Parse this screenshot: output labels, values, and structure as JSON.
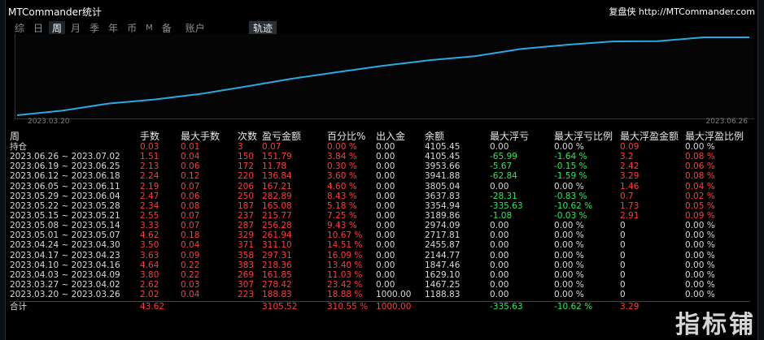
{
  "app": {
    "title": "MTCommander统计",
    "brand": "复盘侠 http://MTCommander.com"
  },
  "tabs": [
    {
      "label": "综",
      "active": false
    },
    {
      "label": "日",
      "active": false
    },
    {
      "label": "周",
      "active": true
    },
    {
      "label": "月",
      "active": false
    },
    {
      "label": "季",
      "active": false
    },
    {
      "label": "年",
      "active": false
    },
    {
      "label": "币",
      "active": false
    },
    {
      "label": "M",
      "active": false
    },
    {
      "label": "备",
      "active": false
    },
    {
      "label": "账户",
      "active": false
    }
  ],
  "track_button": "轨迹",
  "chart_data": {
    "type": "line",
    "x_start": "2023.03.20",
    "x_end": "2023.06.26",
    "series": [
      {
        "values": [
          0,
          188.83,
          467.25,
          629.1,
          847.46,
          1144.77,
          1455.89,
          1717.81,
          1974.09,
          2189.86,
          2354.94,
          2637.83,
          2804.97,
          2941.75,
          2953.53,
          3105.22,
          3105.22
        ]
      }
    ],
    "color": "#29a9e0"
  },
  "table": {
    "headers": [
      "周",
      "手数",
      "最大手数",
      "次数",
      "盈亏金额",
      "百分比%",
      "出入金",
      "余额",
      "最大浮亏",
      "最大浮亏比例",
      "最大浮盈金额",
      "最大浮盈比例"
    ],
    "rows": [
      [
        "持仓",
        "0.03",
        "0.01",
        "3",
        "0.07",
        "0.00 %",
        "0.00",
        "4105.45",
        "0.00",
        "0.00 %",
        "0.09",
        "0.00 %"
      ],
      [
        "2023.06.26 ~ 2023.07.02",
        "1.51",
        "0.04",
        "150",
        "151.79",
        "3.84 %",
        "0.00",
        "4105.45",
        "-65.99",
        "-1.64 %",
        "3.2",
        "0.08 %"
      ],
      [
        "2023.06.19 ~ 2023.06.25",
        "2.13",
        "0.06",
        "172",
        "11.78",
        "0.30 %",
        "0.00",
        "3953.66",
        "-5.67",
        "-0.15 %",
        "2.42",
        "0.06 %"
      ],
      [
        "2023.06.12 ~ 2023.06.18",
        "2.24",
        "0.12",
        "220",
        "136.84",
        "3.60 %",
        "0.00",
        "3941.88",
        "-62.84",
        "-1.59 %",
        "3.29",
        "0.08 %"
      ],
      [
        "2023.06.05 ~ 2023.06.11",
        "2.19",
        "0.07",
        "206",
        "167.21",
        "4.60 %",
        "0.00",
        "3805.04",
        "0.00",
        "0.00 %",
        "1.46",
        "0.04 %"
      ],
      [
        "2023.05.29 ~ 2023.06.04",
        "2.47",
        "0.06",
        "250",
        "282.89",
        "8.43 %",
        "0.00",
        "3637.83",
        "-28.31",
        "-0.83 %",
        "0.7",
        "0.02 %"
      ],
      [
        "2023.05.22 ~ 2023.05.28",
        "2.34",
        "0.08",
        "187",
        "165.08",
        "5.18 %",
        "0.00",
        "3354.94",
        "-335.63",
        "-10.62 %",
        "1.73",
        "0.05 %"
      ],
      [
        "2023.05.15 ~ 2023.05.21",
        "2.55",
        "0.07",
        "237",
        "215.77",
        "7.25 %",
        "0.00",
        "3189.86",
        "-1.08",
        "-0.03 %",
        "2.91",
        "0.09 %"
      ],
      [
        "2023.05.08 ~ 2023.05.14",
        "3.33",
        "0.07",
        "287",
        "256.28",
        "9.43 %",
        "0.00",
        "2974.09",
        "0.00",
        "0.00 %",
        "0",
        "0.00 %"
      ],
      [
        "2023.05.01 ~ 2023.05.07",
        "4.62",
        "0.18",
        "329",
        "261.94",
        "10.67 %",
        "0.00",
        "2717.81",
        "0.00",
        "0.00 %",
        "0",
        "0.00 %"
      ],
      [
        "2023.04.24 ~ 2023.04.30",
        "3.50",
        "0.04",
        "371",
        "311.10",
        "14.51 %",
        "0.00",
        "2455.87",
        "0.00",
        "0.00 %",
        "0",
        "0.00 %"
      ],
      [
        "2023.04.17 ~ 2023.04.23",
        "3.63",
        "0.09",
        "358",
        "297.31",
        "16.09 %",
        "0.00",
        "2144.77",
        "0.00",
        "0.00 %",
        "0",
        "0.00 %"
      ],
      [
        "2023.04.10 ~ 2023.04.16",
        "4.64",
        "0.22",
        "383",
        "218.36",
        "13.40 %",
        "0.00",
        "1847.46",
        "0.00",
        "0.00 %",
        "0",
        "0.00 %"
      ],
      [
        "2023.04.03 ~ 2023.04.09",
        "3.80",
        "0.22",
        "269",
        "161.85",
        "11.03 %",
        "0.00",
        "1629.10",
        "0.00",
        "0.00 %",
        "0",
        "0.00 %"
      ],
      [
        "2023.03.27 ~ 2023.04.02",
        "2.62",
        "0.03",
        "307",
        "278.42",
        "23.42 %",
        "0.00",
        "1467.25",
        "0.00",
        "0.00 %",
        "0",
        "0.00 %"
      ],
      [
        "2023.03.20 ~ 2023.03.26",
        "2.02",
        "0.04",
        "223",
        "188.83",
        "18.88 %",
        "1000.00",
        "1188.83",
        "0.00",
        "0.00 %",
        "0",
        "0.00 %"
      ]
    ],
    "total": [
      "合计",
      "43.62",
      "",
      "",
      "3105.52",
      "310.55 %",
      "1000.00",
      "",
      "-335.63",
      "-10.62 %",
      "3.29",
      ""
    ]
  },
  "watermark": "指标铺"
}
